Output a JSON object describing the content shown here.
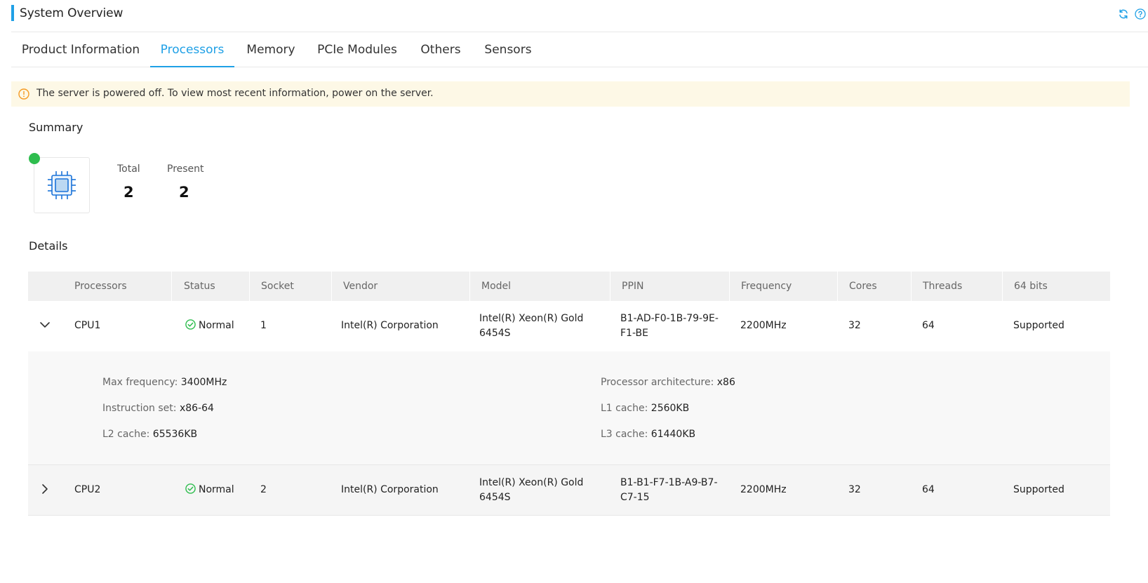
{
  "header": {
    "title": "System Overview",
    "icons": [
      "refresh-icon",
      "help-icon"
    ],
    "accent_color": "#1fa0e6"
  },
  "tabs": [
    {
      "label": "Product Information",
      "active": false
    },
    {
      "label": "Processors",
      "active": true
    },
    {
      "label": "Memory",
      "active": false
    },
    {
      "label": "PCIe Modules",
      "active": false
    },
    {
      "label": "Others",
      "active": false
    },
    {
      "label": "Sensors",
      "active": false
    }
  ],
  "alert": {
    "icon": "info-icon",
    "text": "The server is powered off. To view most recent information, power on the server.",
    "color": "#f59a23"
  },
  "summary": {
    "title": "Summary",
    "status_color": "#2ebd4e",
    "icon": "cpu-chip-icon",
    "total_label": "Total",
    "total_value": "2",
    "present_label": "Present",
    "present_value": "2"
  },
  "details": {
    "title": "Details",
    "columns": [
      "Processors",
      "Status",
      "Socket",
      "Vendor",
      "Model",
      "PPIN",
      "Frequency",
      "Cores",
      "Threads",
      "64 bits"
    ],
    "rows": [
      {
        "expanded": true,
        "processor": "CPU1",
        "status": "Normal",
        "socket": "1",
        "vendor": "Intel(R) Corporation",
        "model_line1": "Intel(R) Xeon(R) Gold",
        "model_line2": "6454S",
        "ppin_line1": "B1-AD-F0-1B-79-9E-",
        "ppin_line2": "F1-BE",
        "frequency": "2200MHz",
        "cores": "32",
        "threads": "64",
        "bits64": "Supported",
        "extra": {
          "max_frequency_label": "Max frequency",
          "max_frequency": "3400MHz",
          "instruction_set_label": "Instruction set",
          "instruction_set": "x86-64",
          "l2_cache_label": "L2 cache",
          "l2_cache": "65536KB",
          "architecture_label": "Processor architecture",
          "architecture": "x86",
          "l1_cache_label": "L1 cache",
          "l1_cache": "2560KB",
          "l3_cache_label": "L3 cache",
          "l3_cache": "61440KB"
        }
      },
      {
        "expanded": false,
        "processor": "CPU2",
        "status": "Normal",
        "socket": "2",
        "vendor": "Intel(R) Corporation",
        "model_line1": "Intel(R) Xeon(R) Gold",
        "model_line2": "6454S",
        "ppin_line1": "B1-B1-F7-1B-A9-B7-",
        "ppin_line2": "C7-15",
        "frequency": "2200MHz",
        "cores": "32",
        "threads": "64",
        "bits64": "Supported"
      }
    ],
    "status_color": "#2ebd4e"
  }
}
